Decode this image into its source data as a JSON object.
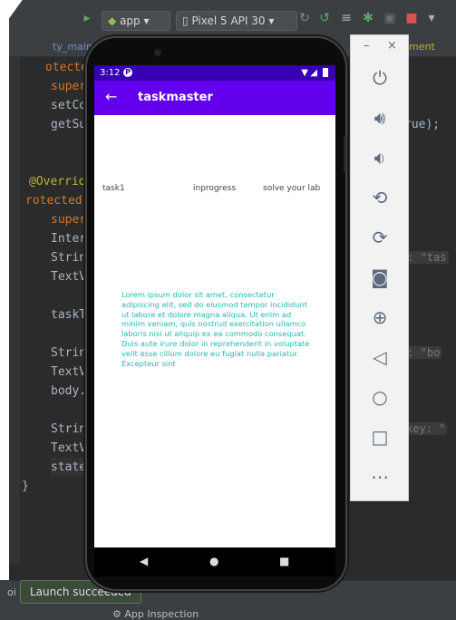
{
  "ide": {
    "toolbar": {
      "run_config": "app",
      "device": "Pixel 5 API 30"
    },
    "tab_text": "ty_main",
    "tab_text_right": "ment",
    "code": [
      {
        "text": "otected"
      },
      {
        "text": "super."
      },
      {
        "text": "setCo"
      },
      {
        "text": "getSu",
        "tail": "rue);"
      },
      {
        "text": "@Override"
      },
      {
        "text": "rotected"
      },
      {
        "text": "super"
      },
      {
        "text": "Inter"
      },
      {
        "text": "Strin",
        "hint": "y: \"tas"
      },
      {
        "text": "TextV"
      },
      {
        "text": "taskT"
      },
      {
        "text": "Strin",
        "hint": "y: \"bo"
      },
      {
        "text": "TextV"
      },
      {
        "text": "body."
      },
      {
        "text": "Strin",
        "hint": "key: \""
      },
      {
        "text": "TextV"
      },
      {
        "text": "state"
      },
      {
        "text": "}"
      }
    ],
    "toast": "Launch succeeded",
    "status_left": "oi",
    "app_inspection": "App Inspection"
  },
  "device": {
    "status_time": "3:12",
    "status_icon": "P",
    "app_title": "taskmaster",
    "row": {
      "task": "task1",
      "state": "inprogress",
      "body": "solve your lab"
    },
    "body_text": "Lorem ipsum dolor sit amet, consectetur adipiscing elit, sed do eiusmod tempor incididunt ut labore et dolore magna aliqua. Ut enim ad minim veniam, quis nostrud exercitation ullamco laboris nisi ut aliquip ex ea commodo consequat. Duis aute irure dolor in reprehenderit in voluptate velit esse cillum dolore eu fugiat nulla pariatur. Excepteur sint",
    "colors": {
      "status_bar": "#3700b3",
      "app_bar": "#6200ee",
      "body_text": "#1fb8b2"
    }
  },
  "emulator_panel": {
    "minimize": "–",
    "close": "×",
    "buttons": [
      "power-icon",
      "volume-up-icon",
      "volume-down-icon",
      "rotate-left-icon",
      "rotate-right-icon",
      "camera-icon",
      "zoom-icon",
      "back-icon",
      "home-icon",
      "overview-icon",
      "more-icon"
    ]
  }
}
